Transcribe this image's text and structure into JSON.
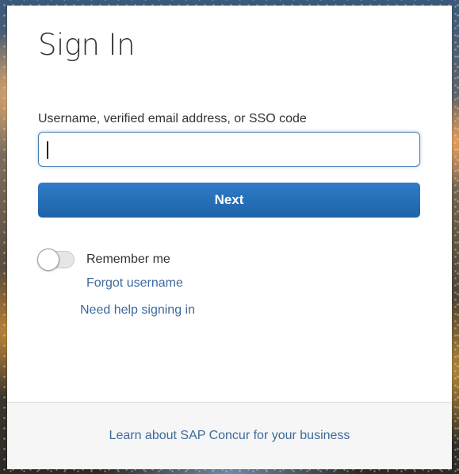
{
  "page": {
    "title": "Sign In"
  },
  "login": {
    "username_label": "Username, verified email address, or SSO code",
    "username_value": "",
    "next_label": "Next",
    "remember_label": "Remember me",
    "remember_checked": false,
    "forgot_username_label": "Forgot username",
    "help_label": "Need help signing in"
  },
  "footer": {
    "learn_more_label": "Learn about SAP Concur for your business"
  },
  "colors": {
    "primary_button": "#1e63a8",
    "link": "#3d6a9c",
    "input_focus_border": "#4a7fb5"
  }
}
